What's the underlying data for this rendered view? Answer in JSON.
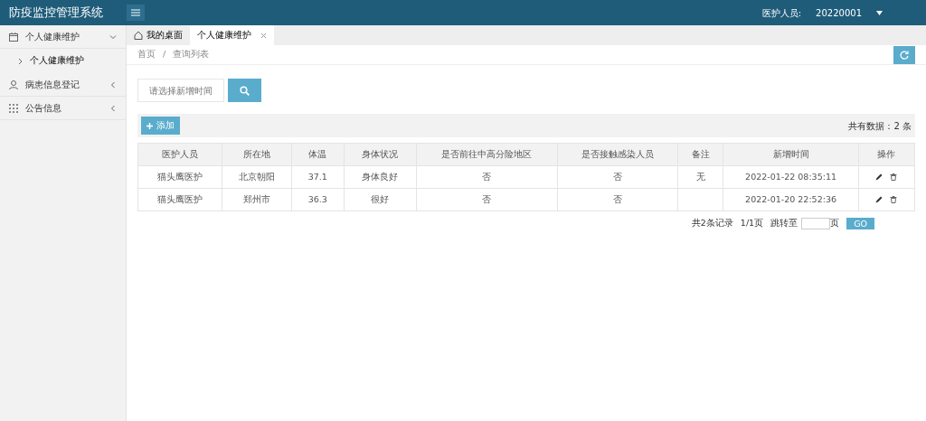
{
  "header": {
    "title": "防疫监控管理系统",
    "user_label": "医护人员:",
    "user_id": "20220001"
  },
  "sidebar": {
    "items": [
      {
        "label": "个人健康维护",
        "expanded": true,
        "children": [
          {
            "label": "个人健康维护",
            "selected": true
          }
        ]
      },
      {
        "label": "病患信息登记",
        "expanded": false
      },
      {
        "label": "公告信息",
        "expanded": false
      }
    ]
  },
  "tabs": [
    {
      "label": "我的桌面",
      "closable": false,
      "selected": false
    },
    {
      "label": "个人健康维护",
      "closable": true,
      "selected": true
    }
  ],
  "breadcrumb": {
    "items": [
      "首页",
      "查询列表"
    ],
    "separator": "/"
  },
  "search": {
    "placeholder": "请选择新增时间"
  },
  "toolbar": {
    "add_button": "添加",
    "total": "共有数据：2 条"
  },
  "table": {
    "columns": [
      "医护人员",
      "所在地",
      "体温",
      "身体状况",
      "是否前往中高分险地区",
      "是否接触感染人员",
      "备注",
      "新增时间",
      "操作"
    ],
    "rows": [
      [
        "猫头鹰医护",
        "北京朝阳",
        "37.1",
        "身体良好",
        "否",
        "否",
        "无",
        "2022-01-22 08:35:11"
      ],
      [
        "猫头鹰医护",
        "郑州市",
        "36.3",
        "很好",
        "否",
        "否",
        "",
        "2022-01-20 22:52:36"
      ]
    ]
  },
  "pagination": {
    "summary": "共2条记录",
    "pages": "1/1页",
    "goto_label": "跳转至",
    "page_suffix": "页",
    "go_button": "GO"
  }
}
